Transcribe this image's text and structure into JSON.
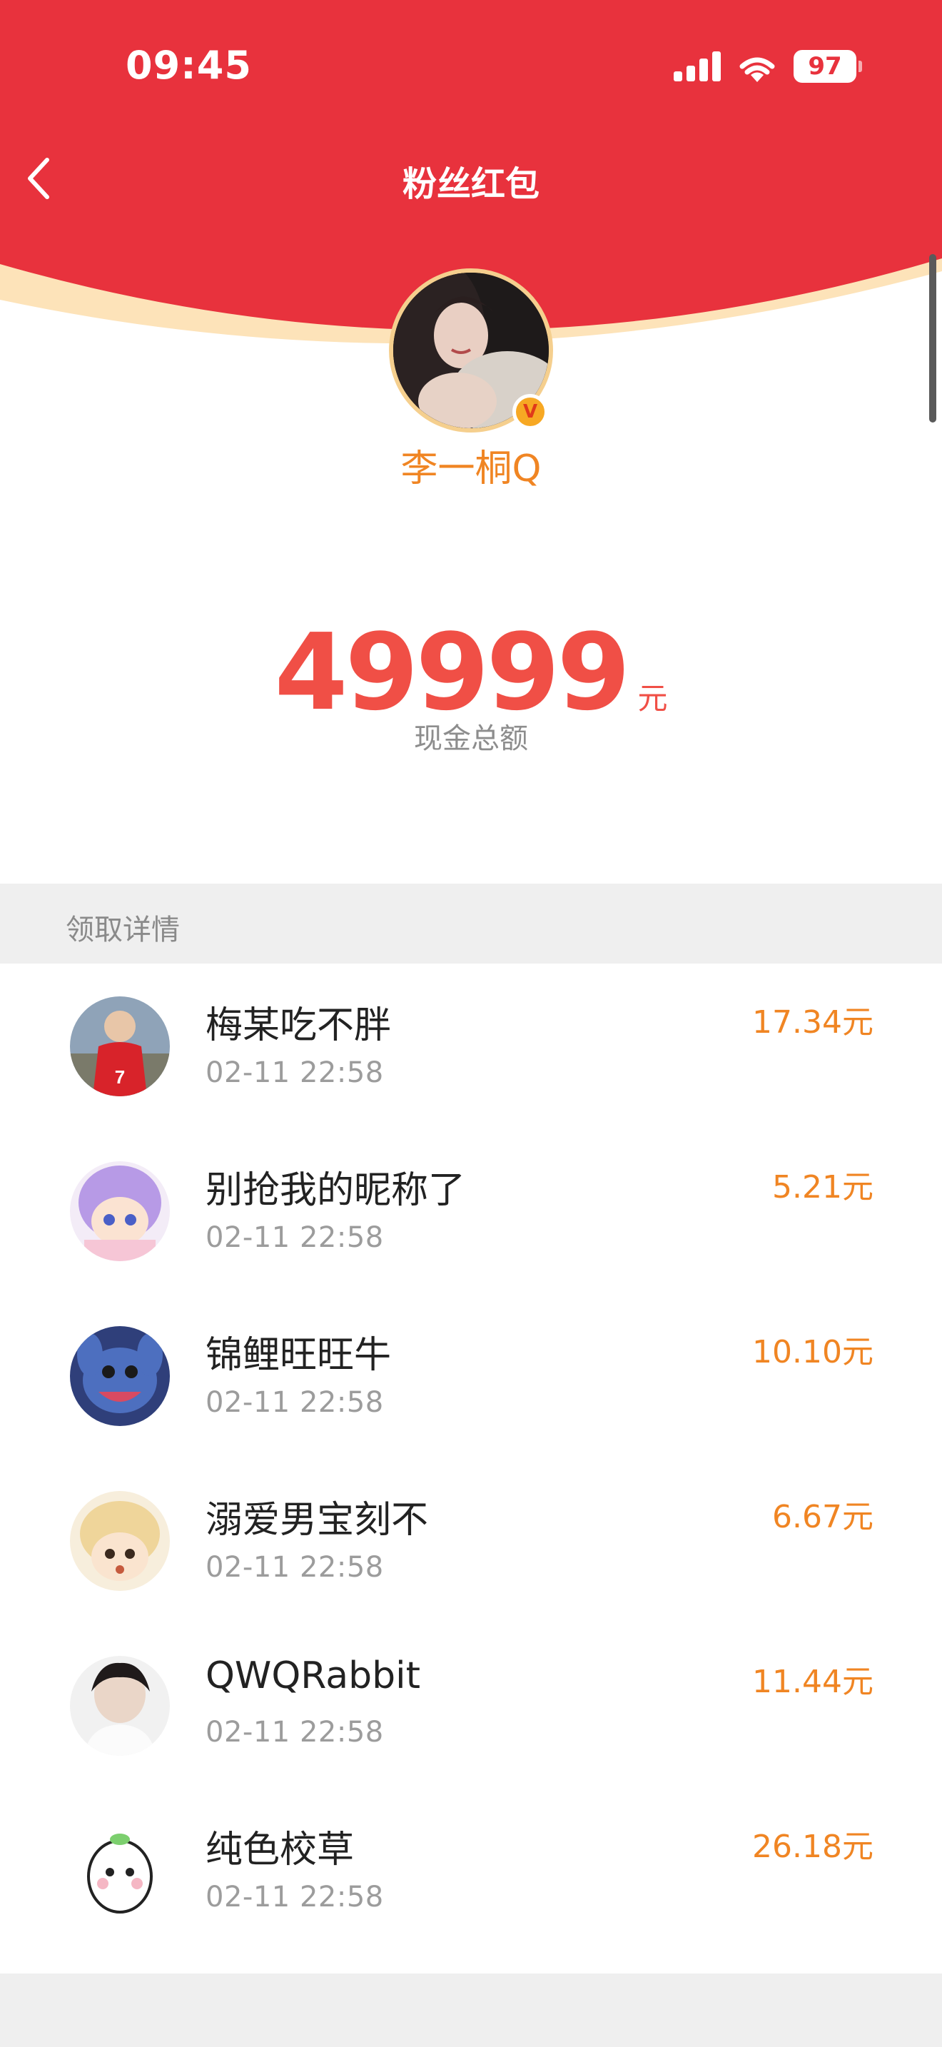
{
  "status_bar": {
    "time": "09:45",
    "battery": "97"
  },
  "nav": {
    "title": "粉丝红包"
  },
  "host": {
    "name": "李一桐Q",
    "verified_mark": "V"
  },
  "packet": {
    "amount": "49999",
    "unit": "元",
    "label": "现金总额"
  },
  "details": {
    "section_title": "领取详情",
    "items": [
      {
        "name": "梅某吃不胖",
        "time": "02-11 22:58",
        "amount": "17.34元"
      },
      {
        "name": "别抢我的昵称了",
        "time": "02-11 22:58",
        "amount": "5.21元"
      },
      {
        "name": "锦鲤旺旺牛",
        "time": "02-11 22:58",
        "amount": "10.10元"
      },
      {
        "name": "溺爱男宝刻不",
        "time": "02-11 22:58",
        "amount": "6.67元"
      },
      {
        "name": "QWQRabbit",
        "time": "02-11 22:58",
        "amount": "11.44元"
      },
      {
        "name": "纯色校草",
        "time": "02-11 22:58",
        "amount": "26.18元"
      }
    ]
  },
  "colors": {
    "header_red": "#e8323d",
    "accent_orange": "#f08523",
    "amount_red": "#f04f46",
    "gold_ring": "#f5cf8e"
  }
}
